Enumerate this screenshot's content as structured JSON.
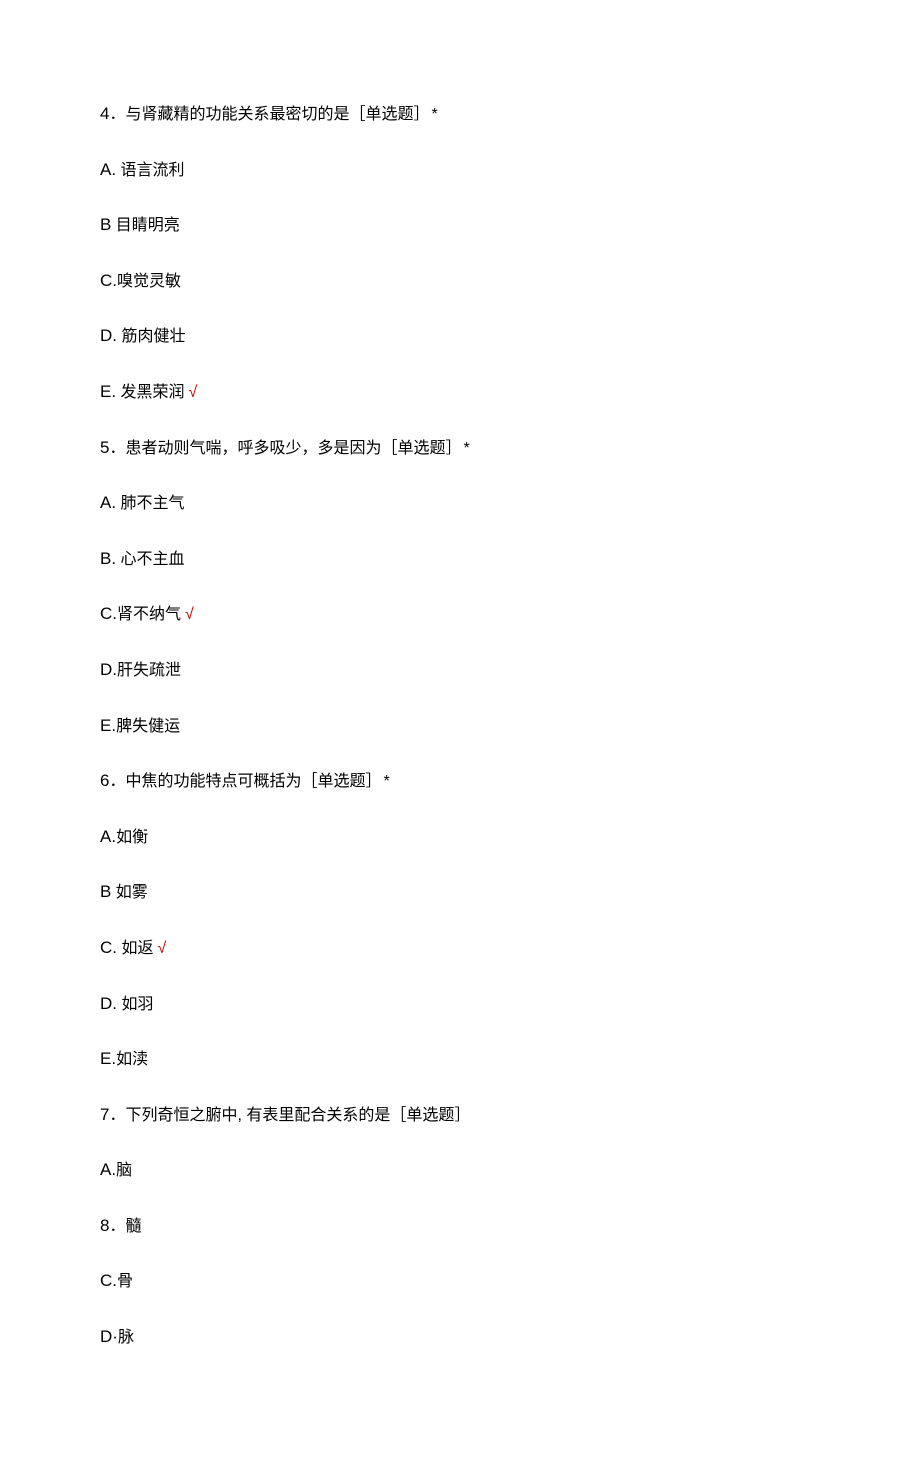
{
  "questions": [
    {
      "number": "4",
      "text": "．与肾藏精的功能关系最密切的是［单选题］",
      "suffix": "*",
      "options": [
        {
          "letter": "A.",
          "text": " 语言流利",
          "correct": false
        },
        {
          "letter": "B",
          "text": " 目睛明亮",
          "correct": false
        },
        {
          "letter": "C.",
          "text": "嗅觉灵敏",
          "correct": false
        },
        {
          "letter": "D.",
          "text": " 筋肉健壮",
          "correct": false
        },
        {
          "letter": "E.",
          "text": " 发黑荣润",
          "correct": true
        }
      ]
    },
    {
      "number": "5",
      "text": "．患者动则气喘，呼多吸少，多是因为［单选题］",
      "suffix": "*",
      "options": [
        {
          "letter": "A.",
          "text": " 肺不主气",
          "correct": false
        },
        {
          "letter": "B.",
          "text": " 心不主血",
          "correct": false
        },
        {
          "letter": "C.",
          "text": "肾不纳气",
          "correct": true
        },
        {
          "letter": "D.",
          "text": "肝失疏泄",
          "correct": false
        },
        {
          "letter": "E.",
          "text": "脾失健运",
          "correct": false
        }
      ]
    },
    {
      "number": "6",
      "text": "．中焦的功能特点可概括为［单选题］",
      "suffix": "*",
      "options": [
        {
          "letter": "A.",
          "text": "如衡",
          "correct": false
        },
        {
          "letter": "B",
          "text": " 如雾",
          "correct": false
        },
        {
          "letter": "C.",
          "text": " 如返",
          "correct": true
        },
        {
          "letter": "D.",
          "text": " 如羽",
          "correct": false
        },
        {
          "letter": "E.",
          "text": "如渎",
          "correct": false
        }
      ]
    },
    {
      "number": "7",
      "text": "．下列奇恒之腑中, 有表里配合关系的是［单选题］",
      "suffix": "",
      "options": [
        {
          "letter": "A.",
          "text": "脑",
          "correct": false
        },
        {
          "letter": "8",
          "text": "．髓",
          "correct": false
        },
        {
          "letter": "C.",
          "text": "骨",
          "correct": false
        },
        {
          "letter": "D·",
          "text": "脉",
          "correct": false
        }
      ]
    }
  ],
  "checkmark": "√"
}
